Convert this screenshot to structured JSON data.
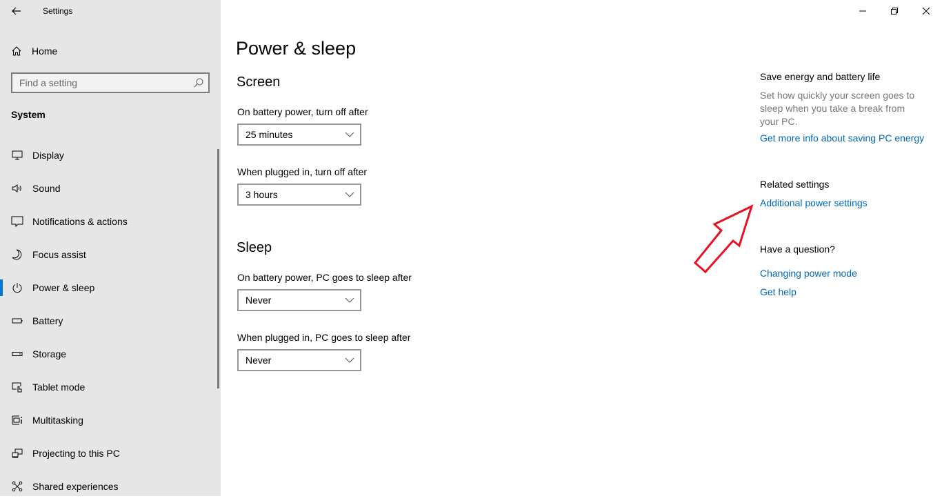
{
  "window": {
    "app_title": "Settings",
    "controls": {
      "minimize": "minimize-icon",
      "restore": "restore-icon",
      "close": "close-icon"
    }
  },
  "sidebar": {
    "back_icon": "back-arrow-icon",
    "home_label": "Home",
    "home_icon": "home-icon",
    "search": {
      "placeholder": "Find a setting",
      "value": "",
      "icon": "search-icon"
    },
    "section_label": "System",
    "items": [
      {
        "label": "Display",
        "icon": "display-icon",
        "active": false
      },
      {
        "label": "Sound",
        "icon": "sound-icon",
        "active": false
      },
      {
        "label": "Notifications & actions",
        "icon": "notifications-icon",
        "active": false
      },
      {
        "label": "Focus assist",
        "icon": "moon-icon",
        "active": false
      },
      {
        "label": "Power & sleep",
        "icon": "power-icon",
        "active": true
      },
      {
        "label": "Battery",
        "icon": "battery-icon",
        "active": false
      },
      {
        "label": "Storage",
        "icon": "storage-icon",
        "active": false
      },
      {
        "label": "Tablet mode",
        "icon": "tablet-mode-icon",
        "active": false
      },
      {
        "label": "Multitasking",
        "icon": "multitasking-icon",
        "active": false
      },
      {
        "label": "Projecting to this PC",
        "icon": "projecting-icon",
        "active": false
      },
      {
        "label": "Shared experiences",
        "icon": "shared-experiences-icon",
        "active": false
      }
    ]
  },
  "main": {
    "page_title": "Power & sleep",
    "screen": {
      "title": "Screen",
      "battery_label": "On battery power, turn off after",
      "battery_value": "25 minutes",
      "plugged_label": "When plugged in, turn off after",
      "plugged_value": "3 hours"
    },
    "sleep": {
      "title": "Sleep",
      "battery_label": "On battery power, PC goes to sleep after",
      "battery_value": "Never",
      "plugged_label": "When plugged in, PC goes to sleep after",
      "plugged_value": "Never"
    }
  },
  "side_panel": {
    "save_heading": "Save energy and battery life",
    "save_text": "Set how quickly your screen goes to sleep when you take a break from your PC.",
    "save_link": "Get more info about saving PC energy",
    "related_heading": "Related settings",
    "related_link": "Additional power settings",
    "question_heading": "Have a question?",
    "question_links": [
      "Changing power mode",
      "Get help"
    ]
  },
  "annotation": {
    "type": "arrow",
    "color": "#e81123",
    "points_to": "Additional power settings"
  },
  "colors": {
    "accent": "#0078d7",
    "link": "#0067b8",
    "sidebar_bg": "#e6e6e6"
  }
}
